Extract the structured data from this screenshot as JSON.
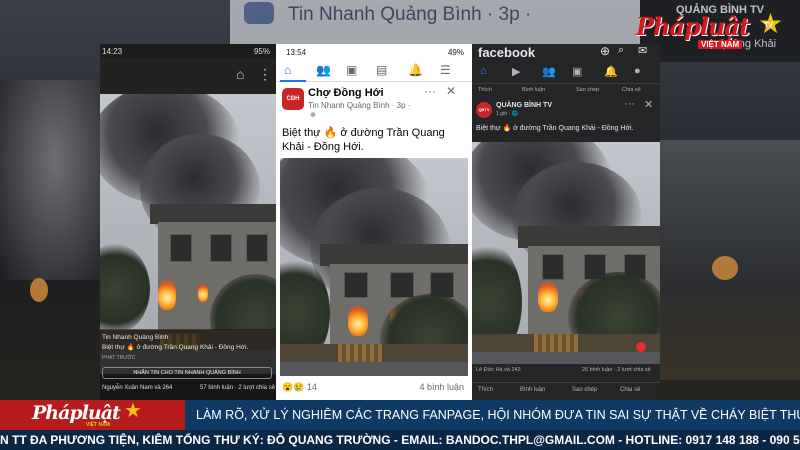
{
  "background": {
    "top_page_name": "Tin Nhanh Quảng Bình · 3p ·",
    "right_page_name": "QUẢNG BÌNH TV",
    "right_post_time": "Quảng Khải"
  },
  "logo": {
    "word": "Phápluật",
    "sub": "VIỆT NAM",
    "tv": "TV"
  },
  "phone_left": {
    "time": "14:23",
    "battery": "95%",
    "source": "Tin Nhanh Quảng Bình",
    "caption": "Biệt thự 🔥 ở đường Trần Quang Khải - Đồng Hới.",
    "button": "NHẮN TIN CHO TIN NHANH QUẢNG BÌNH",
    "reactions": "Nguyễn Xuân Nam và 264",
    "comments": "57 bình luận · 2 lượt chia sẻ",
    "label_phat_truoc": "PHÁT TRƯỚC"
  },
  "phone_mid": {
    "time": "13:54",
    "battery": "49%",
    "group": "Chợ Đồng Hới",
    "page": "Tin Nhanh Quảng Bình · 3p ·",
    "post_text": "Biệt thự 🔥 ở đường Trần Quang Khải - Đồng Hới.",
    "reactions": "14",
    "comments": "4 bình luận"
  },
  "phone_right": {
    "brand": "facebook",
    "page": "QUẢNG BÌNH TV",
    "post_time": "1 giờ · 🌐",
    "post_text": "Biệt thự 🔥 ở đường Trần Quang Khải - Đồng Hới.",
    "strip": [
      "Thích",
      "Bình luận",
      "Sao chép",
      "Chia sẻ"
    ],
    "reactions": "Lê Đức Hà và 243",
    "comments": "26 bình luận · 2 lượt chia sẻ",
    "actions": [
      "Thích",
      "Bình luận",
      "Sao chép",
      "Chia sẻ"
    ]
  },
  "ticker": {
    "logo_word": "Phápluật",
    "logo_sub": "VIỆT NAM",
    "headline": "LÀM RÕ, XỬ LÝ NGHIÊM CÁC TRANG FANPAGE, HỘI NHÓM ĐƯA TIN SAI SỰ THẬT VỀ CHÁY BIỆT THỰ Ở QUẢNG BÌNH.",
    "credits": "N TT ĐA PHƯƠNG TIỆN, KIÊM TỔNG THƯ KÝ: ĐỖ QUANG TRƯỜNG - EMAIL: BANDOC.THPL@GMAIL.COM - HOTLINE: 0917 148 188 - 090 5"
  },
  "colors": {
    "brand_red": "#d7191d",
    "fb_blue": "#1877f2",
    "ticker_blue": "#0f3a66",
    "star_gold": "#f2c21b"
  },
  "icons": {
    "home": "home-icon",
    "friends": "friends-icon",
    "marketplace": "marketplace-icon",
    "news": "news-icon",
    "notifications": "bell-icon",
    "menu": "menu-icon"
  }
}
